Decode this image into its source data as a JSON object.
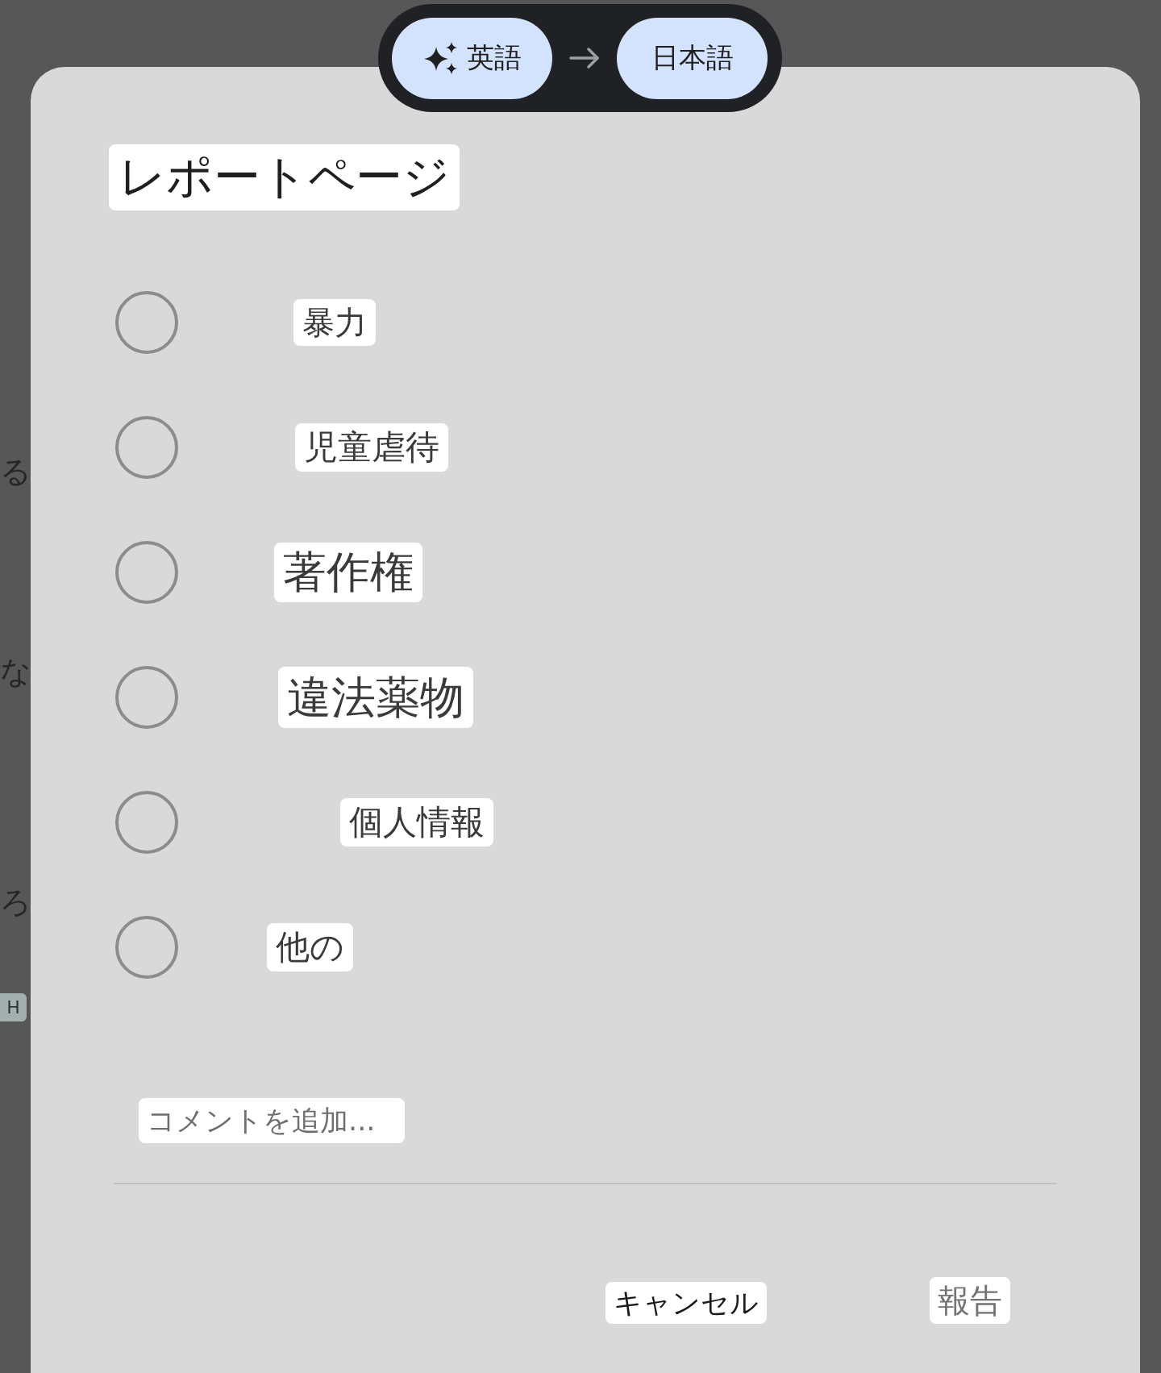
{
  "background_page": {
    "text_fragments": [
      "る",
      "な",
      "ろ"
    ],
    "badge": "H"
  },
  "language_bar": {
    "source": "英語",
    "target": "日本語"
  },
  "dialog": {
    "title": "レポートページ",
    "options": [
      {
        "label": "暴力",
        "selected": false
      },
      {
        "label": "児童虐待",
        "selected": false
      },
      {
        "label": "著作権",
        "selected": false
      },
      {
        "label": "違法薬物",
        "selected": false
      },
      {
        "label": "個人情報",
        "selected": false
      },
      {
        "label": "他の",
        "selected": false
      }
    ],
    "comment": {
      "placeholder": "コメントを追加..."
    },
    "buttons": [
      {
        "label": "キャンセル",
        "disabled": false
      },
      {
        "label": "報告",
        "disabled": true
      }
    ]
  }
}
